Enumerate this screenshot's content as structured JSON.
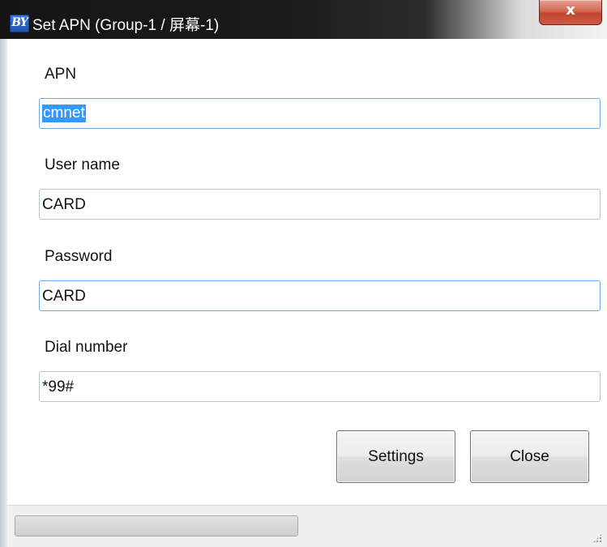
{
  "window": {
    "app_icon_text": "BY",
    "title": "Set APN   (Group-1 / 屏幕-1)",
    "close_glyph": "x"
  },
  "form": {
    "apn": {
      "label": "APN",
      "value": "cmnet",
      "selected": true
    },
    "username": {
      "label": "User name",
      "value": "CARD"
    },
    "password": {
      "label": "Password",
      "value": "CARD"
    },
    "dial": {
      "label": "Dial number",
      "value": "*99#"
    }
  },
  "buttons": {
    "settings": "Settings",
    "close": "Close"
  },
  "colors": {
    "selection": "#3399ff",
    "close_button": "#c0452f",
    "focus_border": "#6ea8de"
  },
  "icons": {
    "app": "app-logo-icon",
    "close": "close-icon",
    "resize": "resize-grip-icon"
  }
}
